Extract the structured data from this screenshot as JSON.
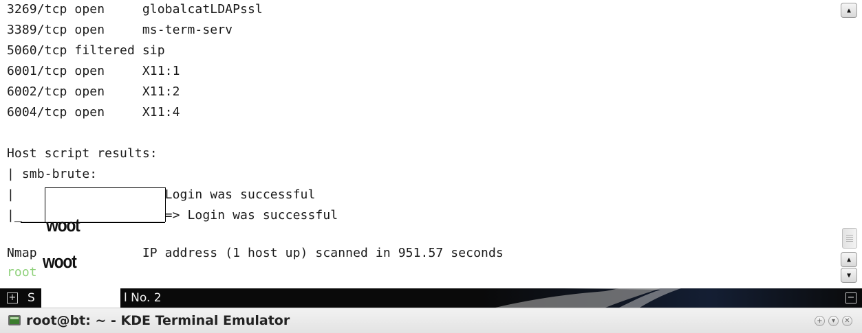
{
  "terminal": {
    "lines": [
      "3269/tcp open     globalcatLDAPssl",
      "3389/tcp open     ms-term-serv",
      "5060/tcp filtered sip",
      "6001/tcp open     X11:1",
      "6002/tcp open     X11:2",
      "6004/tcp open     X11:4",
      "",
      "Host script results:",
      "| smb-brute:",
      "|                  > Login was successful",
      "|_                 ) => Login was successful",
      "",
      "Nmap              IP address (1 host up) scanned in 951.57 seconds"
    ],
    "prompt": "root",
    "redaction_labels": [
      "woot",
      "woot"
    ]
  },
  "tabbar": {
    "label_start": "S",
    "label_end": "l No. 2",
    "new_tab_icon": "plus-square-icon",
    "close_tab_icon": "minus-square-icon"
  },
  "titlebar": {
    "title": "root@bt: ~ - KDE Terminal Emulator",
    "app_icon": "terminal-icon",
    "buttons": [
      "+",
      "▾",
      "✕"
    ]
  },
  "scrollbar": {
    "up_arrow": "▲",
    "down_arrow": "▼"
  },
  "colors": {
    "prompt": "#8fd17b",
    "tabbar_bg": "#0a0a0a"
  }
}
